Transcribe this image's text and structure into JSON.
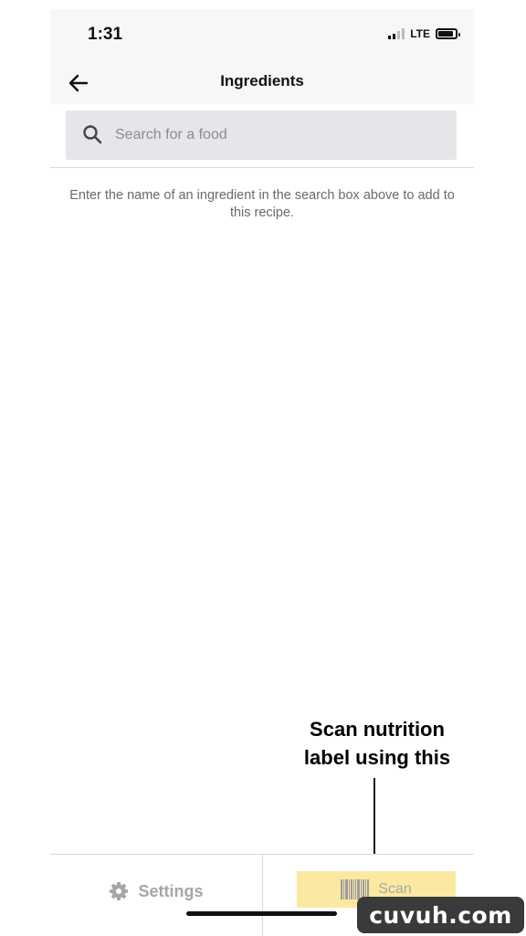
{
  "status_bar": {
    "time": "1:31",
    "network": "LTE"
  },
  "header": {
    "title": "Ingredients",
    "back_icon": "arrow-left-icon"
  },
  "search": {
    "placeholder": "Search for a food",
    "value": "",
    "icon": "search-icon"
  },
  "helper_text": "Enter the name of an ingredient in the search box above to add to this recipe.",
  "annotation": {
    "text": "Scan nutrition label using this"
  },
  "tabs": {
    "settings": {
      "label": "Settings",
      "icon": "gear-icon"
    },
    "scan": {
      "label": "Scan",
      "icon": "barcode-icon",
      "highlight_color": "#fbe9a1"
    }
  },
  "watermark": "cuvuh.com"
}
